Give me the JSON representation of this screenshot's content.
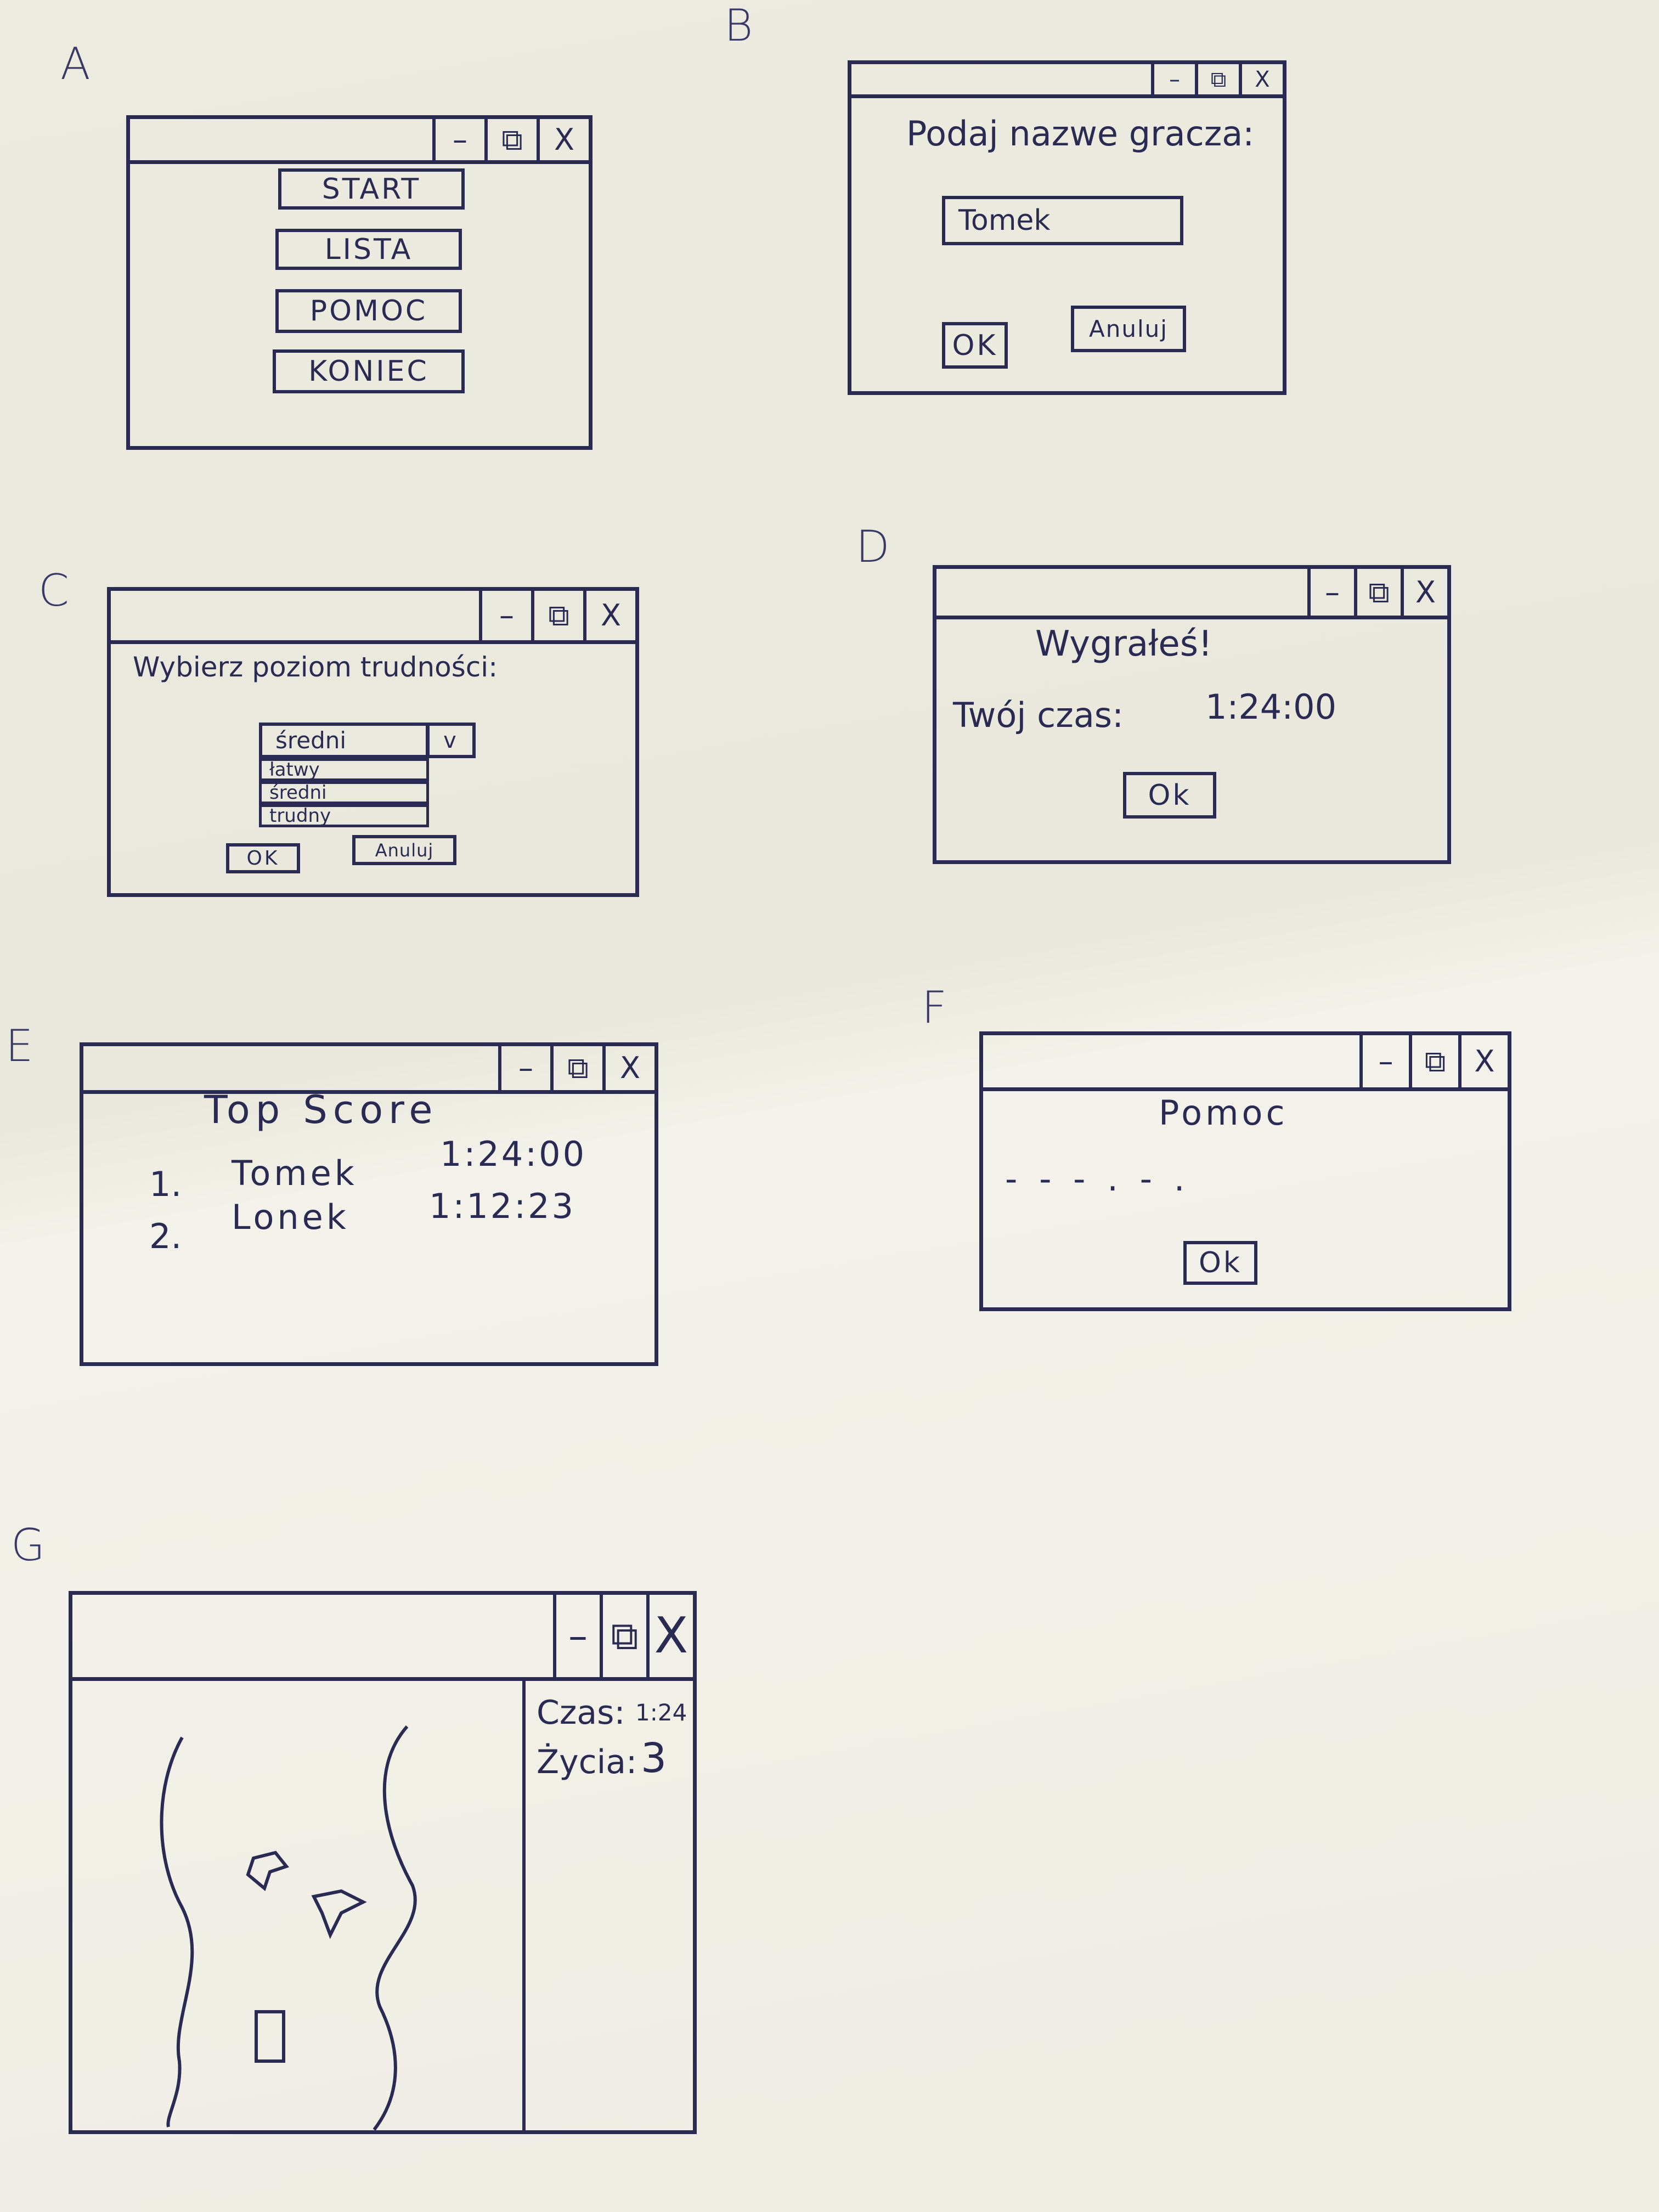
{
  "sketch_letters": [
    "A",
    "B",
    "C",
    "D",
    "E",
    "F",
    "G"
  ],
  "main_menu": {
    "buttons": [
      "START",
      "LISTA",
      "POMOC",
      "KONIEC"
    ]
  },
  "window_controls": {
    "minimize": "–",
    "maximize": "⧉",
    "close": "X"
  },
  "player_dialog": {
    "prompt": "Podaj nazwe gracza:",
    "name_value": "Tomek",
    "ok_label": "OK",
    "cancel_label": "Anuluj"
  },
  "difficulty_dialog": {
    "prompt": "Wybierz poziom trudności:",
    "selected": "średni",
    "dropdown_arrow": "v",
    "options": [
      "łatwy",
      "średni",
      "trudny"
    ],
    "ok_label": "OK",
    "cancel_label": "Anuluj"
  },
  "win_dialog": {
    "heading": "Wygrałeś!",
    "time_label": "Twój czas:",
    "time_value": "1:24:00",
    "ok_label": "Ok"
  },
  "top_score": {
    "title": "Top Score",
    "rows": [
      {
        "rank": "1.",
        "name": "Tomek",
        "time": "1:24:00"
      },
      {
        "rank": "2.",
        "name": "Lonek",
        "time": "1:12:23"
      }
    ]
  },
  "help_dialog": {
    "title": "Pomoc",
    "body": "- - - . - .",
    "ok_label": "Ok"
  },
  "game_window": {
    "time_label": "Czas:",
    "time_value": "1:24",
    "lives_label": "Życia:",
    "lives_value": "3"
  }
}
